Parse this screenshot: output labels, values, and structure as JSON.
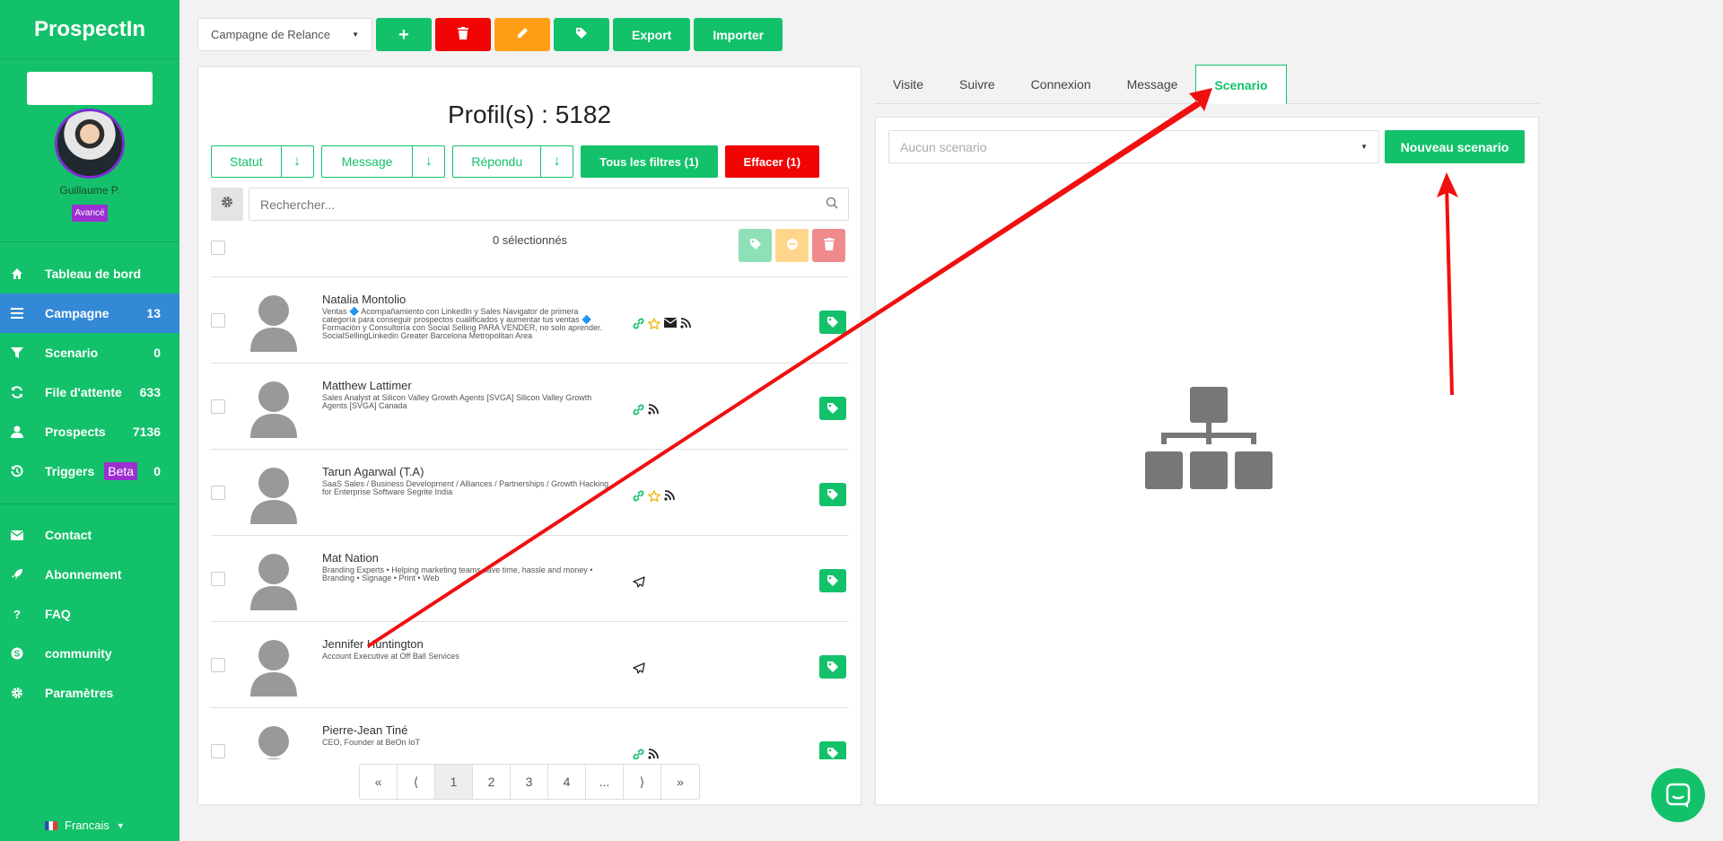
{
  "app": {
    "logo": "ProspectIn"
  },
  "user": {
    "name": "Guillaume P.",
    "badge": "Avancé"
  },
  "sidebar": {
    "items": [
      {
        "label": "Tableau de bord",
        "icon": "home-icon",
        "count": ""
      },
      {
        "label": "Campagne",
        "icon": "list-icon",
        "count": "13"
      },
      {
        "label": "Scenario",
        "icon": "filter-icon",
        "count": "0"
      },
      {
        "label": "File d'attente",
        "icon": "refresh-icon",
        "count": "633"
      },
      {
        "label": "Prospects",
        "icon": "user-icon",
        "count": "7136"
      },
      {
        "label": "Triggers",
        "icon": "history-icon",
        "count": "0",
        "badge": "Beta"
      }
    ],
    "secondary": [
      {
        "label": "Contact",
        "icon": "envelope-icon"
      },
      {
        "label": "Abonnement",
        "icon": "rocket-icon"
      },
      {
        "label": "FAQ",
        "icon": "question-icon"
      },
      {
        "label": "community",
        "icon": "skype-icon"
      },
      {
        "label": "Paramètres",
        "icon": "gear-icon"
      }
    ],
    "language": "Francais"
  },
  "toolbar": {
    "campaign": "Campagne de Relance",
    "export_label": "Export",
    "import_label": "Importer"
  },
  "prospects": {
    "count_title": "Profil(s) : 5182",
    "filters": {
      "statut": "Statut",
      "message": "Message",
      "repondu": "Répondu",
      "all_filters": "Tous les filtres (1)",
      "clear": "Effacer (1)"
    },
    "search_placeholder": "Rechercher...",
    "selected": "0 sélectionnés",
    "rows": [
      {
        "name": "Natalia Montolio",
        "desc": "Ventas 🔷 Acompañamiento con LinkedIn y Sales Navigator de primera categoría para conseguir prospectos cualificados y aumentar tus ventas 🔷 Formación y Consultoría con Social Selling PARA VENDER, no solo aprender. SocialSellingLinkedin Greater Barcelona Metropolitan Area",
        "icons": [
          "link",
          "star",
          "mail",
          "rss"
        ]
      },
      {
        "name": "Matthew Lattimer",
        "desc": "Sales Analyst at Silicon Valley Growth Agents [SVGA] Silicon Valley Growth Agents [SVGA] Canada",
        "icons": [
          "link",
          "rss"
        ]
      },
      {
        "name": "Tarun Agarwal (T.A)",
        "desc": "SaaS Sales / Business Development / Alliances / Partnerships / Growth Hacking for Enterprise Software Segrite India",
        "icons": [
          "link",
          "star",
          "rss"
        ]
      },
      {
        "name": "Mat Nation",
        "desc": "Branding Experts • Helping marketing teams save time, hassle and money • Branding • Signage • Print • Web",
        "icons": [
          "send"
        ]
      },
      {
        "name": "Jennifer Huntington",
        "desc": "Account Executive at Off Ball Services",
        "icons": [
          "send"
        ]
      },
      {
        "name": "Pierre-Jean Tiné",
        "desc": "CEO, Founder at BeOn IoT",
        "icons": [
          "link",
          "rss"
        ]
      }
    ],
    "pagination": [
      "«",
      "⟨",
      "1",
      "2",
      "3",
      "4",
      "...",
      "⟩",
      "»"
    ]
  },
  "tabs": [
    "Visite",
    "Suivre",
    "Connexion",
    "Message",
    "Scenario"
  ],
  "scenario": {
    "select_placeholder": "Aucun scenario",
    "new_label": "Nouveau scenario"
  },
  "colors": {
    "brand_green": "#13c16a",
    "danger": "#f00404",
    "warning": "#ff9e14",
    "active_blue": "#3489d6",
    "beta_purple": "#9b2fd0"
  }
}
